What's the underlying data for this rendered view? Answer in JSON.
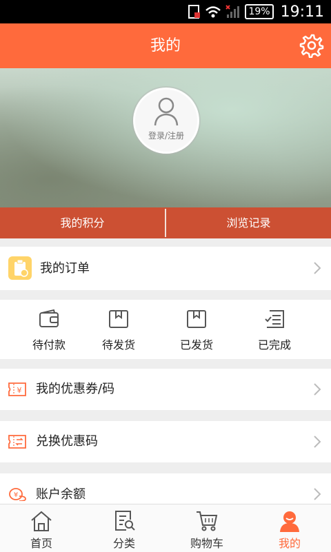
{
  "status_bar": {
    "battery": "19%",
    "time": "19:11"
  },
  "header": {
    "title": "我的",
    "settings_icon": "gear-icon"
  },
  "profile": {
    "login_label": "登录/注册",
    "avatar_icon": "user-icon"
  },
  "hero_tabs": [
    {
      "label": "我的积分"
    },
    {
      "label": "浏览记录"
    }
  ],
  "orders": {
    "label": "我的订单",
    "icon": "clipboard-icon",
    "statuses": [
      {
        "label": "待付款",
        "icon": "wallet-icon"
      },
      {
        "label": "待发货",
        "icon": "box-icon"
      },
      {
        "label": "已发货",
        "icon": "box-icon"
      },
      {
        "label": "已完成",
        "icon": "checklist-icon"
      }
    ]
  },
  "menu": [
    {
      "label": "我的优惠券/码",
      "icon": "coupon-icon"
    },
    {
      "label": "兑换优惠码",
      "icon": "exchange-coupon-icon"
    },
    {
      "label": "账户余额",
      "icon": "coins-icon"
    }
  ],
  "bottom_nav": [
    {
      "label": "首页",
      "icon": "home-icon"
    },
    {
      "label": "分类",
      "icon": "category-search-icon"
    },
    {
      "label": "购物车",
      "icon": "cart-icon"
    },
    {
      "label": "我的",
      "icon": "user-icon",
      "active": true
    }
  ],
  "colors": {
    "accent": "#ff6a3c",
    "tab_bar": "#cc5033",
    "active_nav": "#ff6a3c"
  }
}
